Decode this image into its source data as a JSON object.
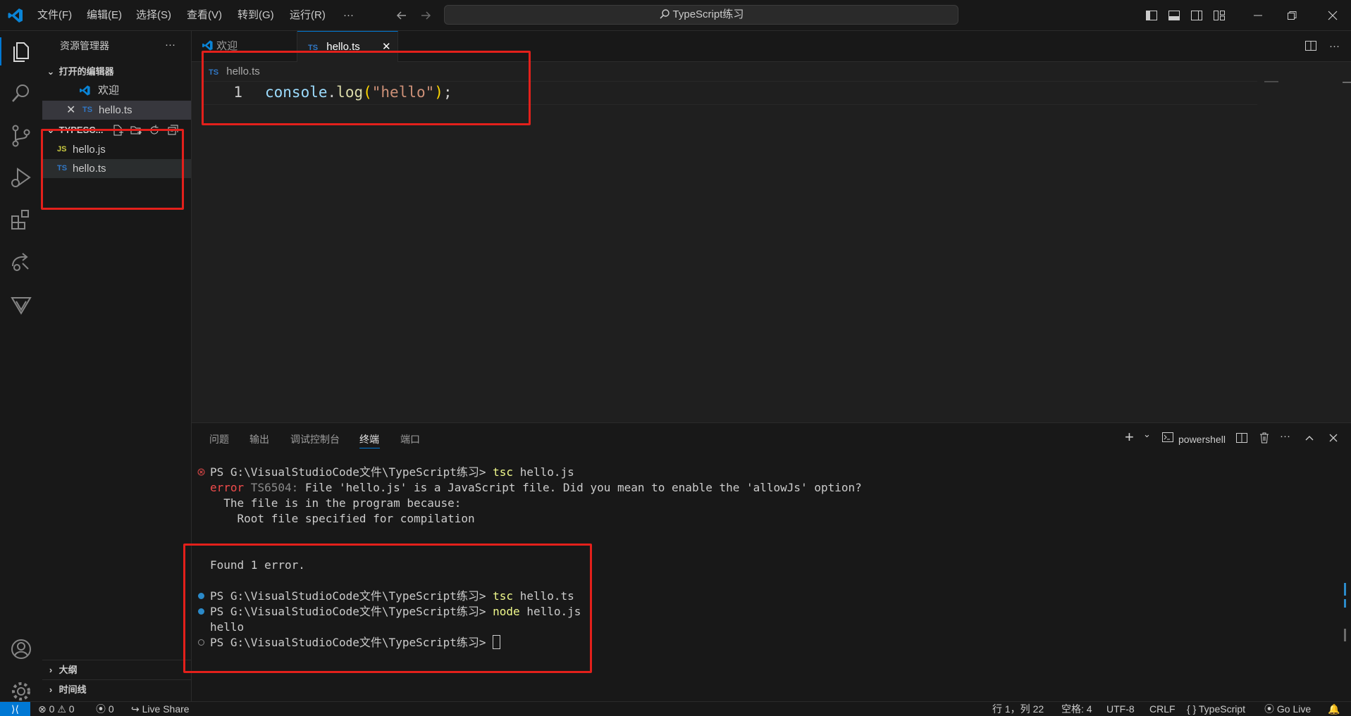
{
  "menu": [
    "文件(F)",
    "编辑(E)",
    "选择(S)",
    "查看(V)",
    "转到(G)",
    "运行(R)",
    "···"
  ],
  "search": {
    "text": "TypeScript练习"
  },
  "sidebar": {
    "title": "资源管理器",
    "more": "···",
    "open_editors_label": "打开的编辑器",
    "open_editors": [
      {
        "badge": "",
        "name": "欢迎"
      },
      {
        "badge": "TS",
        "name": "hello.ts"
      }
    ],
    "folder_label": "TYPESC...",
    "files": [
      {
        "badge": "JS",
        "name": "hello.js"
      },
      {
        "badge": "TS",
        "name": "hello.ts"
      }
    ],
    "outline_label": "大纲",
    "timeline_label": "时间线"
  },
  "tabs": [
    {
      "label": "欢迎",
      "badge": ""
    },
    {
      "label": "hello.ts",
      "badge": "TS"
    }
  ],
  "breadcrumb": {
    "badge": "TS",
    "file": "hello.ts"
  },
  "editor": {
    "line_number": "1",
    "code": {
      "obj": "console",
      "dot": ".",
      "fn": "log",
      "open": "(",
      "str": "\"hello\"",
      "close": ")",
      "semi": ";"
    }
  },
  "panel": {
    "tabs": [
      "问题",
      "输出",
      "调试控制台",
      "终端",
      "端口"
    ],
    "active_tab": "终端",
    "shell": "powershell"
  },
  "terminal": {
    "prompt": "PS G:\\VisualStudioCode文件\\TypeScript练习> ",
    "cmd1": "tsc",
    "arg1": " hello.js",
    "err_word": "error",
    "err_code": " TS6504:",
    "err_msg": " File 'hello.js' is a JavaScript file. Did you mean to enable the 'allowJs' option?",
    "l3": "  The file is in the program because:",
    "l4": "    Root file specified for compilation",
    "found": "Found 1 error.",
    "cmd2": "tsc",
    "arg2": " hello.ts",
    "cmd3": "node",
    "arg3": " hello.js",
    "output": "hello"
  },
  "statusbar": {
    "errors": "0",
    "warnings": "0",
    "ports": "0",
    "live_share": "Live Share",
    "position": "行 1，列 22",
    "spaces": "空格: 4",
    "encoding": "UTF-8",
    "eol": "CRLF",
    "language": "TypeScript",
    "go_live": "Go Live"
  },
  "colors": {
    "accent": "#0078d4",
    "annotation_red": "#e3201b",
    "keyword_yellow": "#dcdcaa",
    "string": "#ce9178",
    "variable": "#9cdcfe"
  }
}
